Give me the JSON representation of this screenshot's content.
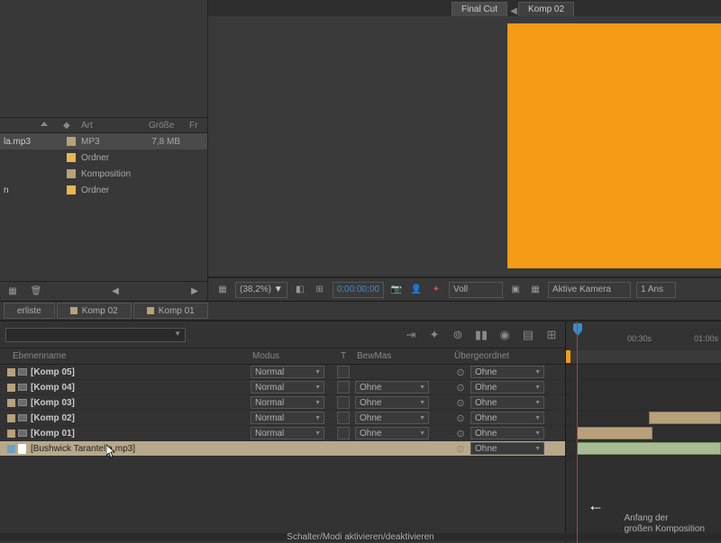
{
  "comp_tabs": {
    "active": "Final Cut",
    "inactive": "Komp 02"
  },
  "project": {
    "cols": {
      "art": "Art",
      "groesse": "Größe",
      "fr": "Fr"
    },
    "items": [
      {
        "name": "la.mp3",
        "color": "#b8a17a",
        "art": "MP3",
        "size": "7,8 MB"
      },
      {
        "name": "",
        "color": "#eab64f",
        "art": "Ordner",
        "size": ""
      },
      {
        "name": "",
        "color": "#b8a17a",
        "art": "Komposition",
        "size": ""
      },
      {
        "name": "n",
        "color": "#eab64f",
        "art": "Ordner",
        "size": ""
      }
    ]
  },
  "viewer_bar": {
    "zoom": "(38,2%)",
    "timecode": "0:00:00:00",
    "res": "Voll",
    "camera": "Aktive Kamera",
    "views": "1 Ans"
  },
  "timeline_tabs": {
    "t0": "erliste",
    "t1": "Komp 02",
    "t2": "Komp 01"
  },
  "tl_cols": {
    "ebene": "Ebenenname",
    "modus": "Modus",
    "t": "T",
    "bewmas": "BewMas",
    "ueber": "Übergeordnet"
  },
  "layers": [
    {
      "name": "[Komp 05]",
      "modus": "Normal",
      "bewmas": "",
      "ueber": "Ohne",
      "type": "comp"
    },
    {
      "name": "[Komp 04]",
      "modus": "Normal",
      "bewmas": "Ohne",
      "ueber": "Ohne",
      "type": "comp"
    },
    {
      "name": "[Komp 03]",
      "modus": "Normal",
      "bewmas": "Ohne",
      "ueber": "Ohne",
      "type": "comp"
    },
    {
      "name": "[Komp 02]",
      "modus": "Normal",
      "bewmas": "Ohne",
      "ueber": "Ohne",
      "type": "comp"
    },
    {
      "name": "[Komp 01]",
      "modus": "Normal",
      "bewmas": "Ohne",
      "ueber": "Ohne",
      "type": "comp"
    },
    {
      "name": "[Bushwick Tarantella.mp3]",
      "modus": "",
      "bewmas": "",
      "ueber": "Ohne",
      "type": "audio",
      "selected": true
    }
  ],
  "time_ruler": {
    "t1": "00:30s",
    "t2": "01:00s"
  },
  "annotation": {
    "line1": "Anfang der",
    "line2": "großen Komposition"
  },
  "status": "Schalter/Modi aktivieren/deaktivieren"
}
